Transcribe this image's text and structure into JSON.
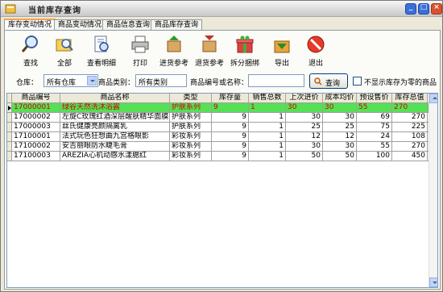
{
  "window": {
    "title": "当前库存查询"
  },
  "tabs": [
    {
      "label": "库存变动情况",
      "active": true
    },
    {
      "label": "商品变动情况",
      "active": false
    },
    {
      "label": "商品信息查询",
      "active": false
    },
    {
      "label": "商品库存查询",
      "active": false
    }
  ],
  "toolbar": {
    "find": "查找",
    "all": "全部",
    "detail": "查看明细",
    "print": "打印",
    "purchase_ref": "进货参考",
    "return_ref": "退货参考",
    "split_bundle": "拆分捆绑",
    "export": "导出",
    "exit": "退出"
  },
  "search": {
    "warehouse_label": "仓库：",
    "warehouse_value": "所有仓库",
    "category_label": "商品类别：",
    "category_value": "所有类别",
    "code_label": "商品编号或名称：",
    "code_value": "",
    "query_button": "查询",
    "hide_zero_label": "不显示库存为零的商品",
    "hide_zero_checked": false
  },
  "grid": {
    "headers": [
      "商品编号",
      "商品名称",
      "类型",
      "库存量",
      "销售总数",
      "上次进价",
      "成本均价",
      "预设售价",
      "库存总值",
      "("
    ],
    "rows": [
      [
        "17000001",
        "绿谷天然洗沐浴露",
        "护肤系列",
        "9",
        "1",
        "30",
        "30",
        "55",
        "270",
        "("
      ],
      [
        "17000002",
        "左旋C玫瑰红酒深层醒肤精华面膜",
        "护肤系列",
        "9",
        "1",
        "30",
        "30",
        "69",
        "270",
        "("
      ],
      [
        "17000003",
        "丝氏健康亮颜隔离乳",
        "护肤系列",
        "9",
        "1",
        "25",
        "25",
        "75",
        "225",
        "1"
      ],
      [
        "17100001",
        "法式玩色狂想曲九宫格眼影",
        "彩妆系列",
        "9",
        "1",
        "12",
        "12",
        "24",
        "108",
        "("
      ],
      [
        "17100002",
        "安吉丽眼防水睫毛膏",
        "彩妆系列",
        "9",
        "1",
        "30",
        "30",
        "55",
        "270",
        "("
      ],
      [
        "17100003",
        "AREZIA心机动感水漾腮红",
        "彩妆系列",
        "9",
        "1",
        "50",
        "50",
        "100",
        "450",
        "1"
      ]
    ],
    "selected_row": 0,
    "colors": {
      "selected_bg": "#55e055",
      "selected_text": "#d10000"
    }
  }
}
